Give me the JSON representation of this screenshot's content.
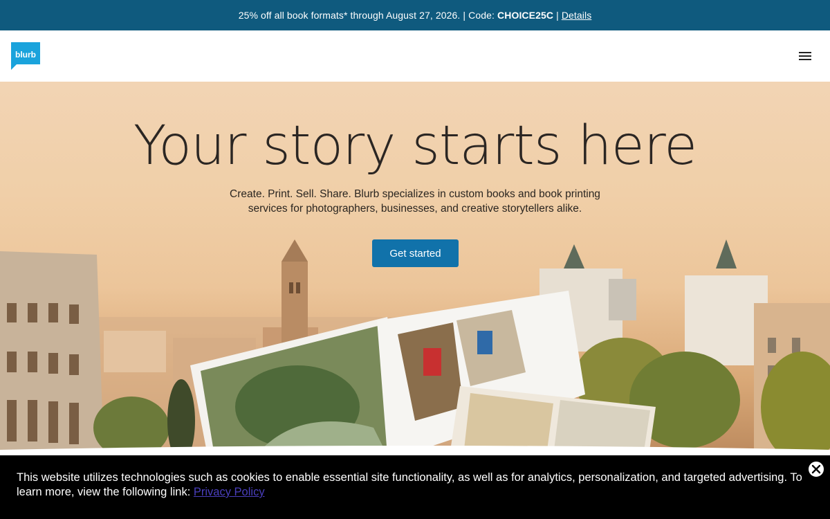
{
  "promo": {
    "text": "25% off all book formats* through August 27, 2026.",
    "code_label": "Code:",
    "code": "CHOICE25C",
    "details_link": "Details"
  },
  "header": {
    "logo_text": "blurb",
    "menu_icon": "hamburger-menu-icon"
  },
  "hero": {
    "title": "Your story starts here",
    "subtitle_line1": "Create. Print. Sell. Share. Blurb specializes in custom books and book printing",
    "subtitle_line2": "services for photographers, businesses, and creative storytellers alike.",
    "cta_label": "Get started"
  },
  "cookie": {
    "text": "This website utilizes technologies such as cookies to enable essential site functionality, as well as for analytics, personalization, and targeted advertising. To learn more, view the following link:",
    "link": "Privacy Policy",
    "close_icon": "close-icon"
  },
  "colors": {
    "promo_bg": "#0f5a7e",
    "brand_blue": "#1aa3dc",
    "cta_bg": "#1172aa",
    "cookie_bg": "#000000",
    "cookie_link": "#4a3fbd"
  }
}
